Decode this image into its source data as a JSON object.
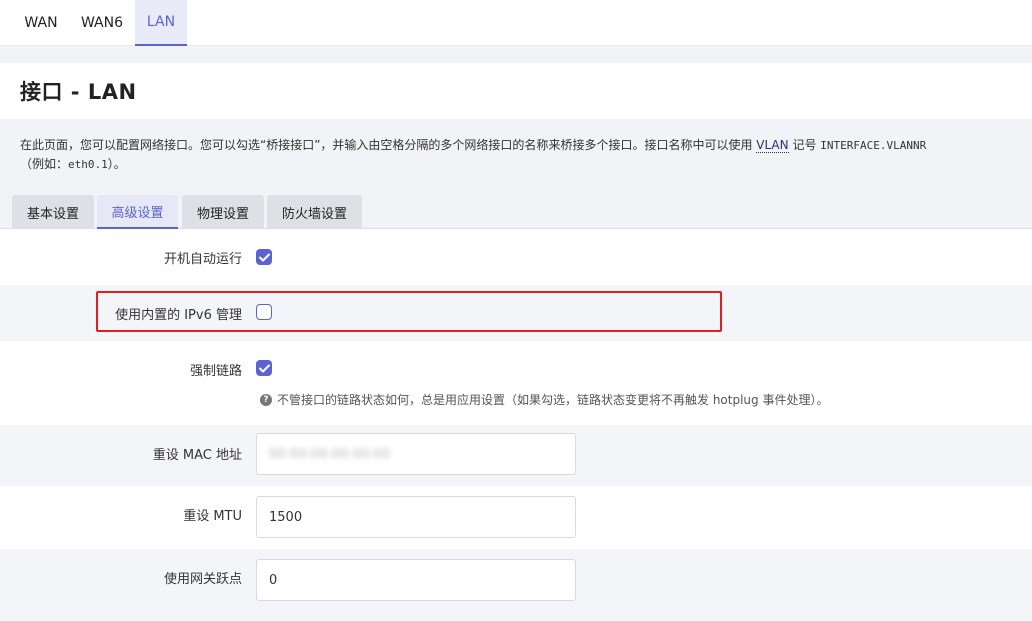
{
  "top_tabs": [
    {
      "label": "WAN"
    },
    {
      "label": "WAN6"
    },
    {
      "label": "LAN",
      "active": true
    }
  ],
  "page": {
    "title": "接口 - LAN",
    "description_part1": "在此页面，您可以配置网络接口。您可以勾选“桥接接口”，并输入由空格分隔的多个网络接口的名称来桥接多个接口。接口名称中可以使用 ",
    "description_vlan": "VLAN",
    "description_part2": " 记号 ",
    "description_code1": "INTERFACE.VLANNR",
    "description_part3": "（例如：",
    "description_code2": "eth0.1",
    "description_part4": "）。"
  },
  "sub_tabs": [
    {
      "label": "基本设置"
    },
    {
      "label": "高级设置",
      "active": true
    },
    {
      "label": "物理设置"
    },
    {
      "label": "防火墙设置"
    }
  ],
  "fields": {
    "auto_start": {
      "label": "开机自动运行",
      "checked": true
    },
    "ipv6_management": {
      "label": "使用内置的 IPv6 管理",
      "checked": false
    },
    "force_link": {
      "label": "强制链路",
      "checked": true,
      "help": "不管接口的链路状态如何，总是用应用设置（如果勾选，链路状态变更将不再触发 hotplug 事件处理）。"
    },
    "mac": {
      "label": "重设 MAC 地址",
      "value": "00:00:00:00:00:00"
    },
    "mtu": {
      "label": "重设 MTU",
      "value": "1500"
    },
    "gateway_metric": {
      "label": "使用网关跃点",
      "value": "0"
    }
  },
  "colors": {
    "accent": "#5b63d3",
    "highlight": "#e02020"
  }
}
